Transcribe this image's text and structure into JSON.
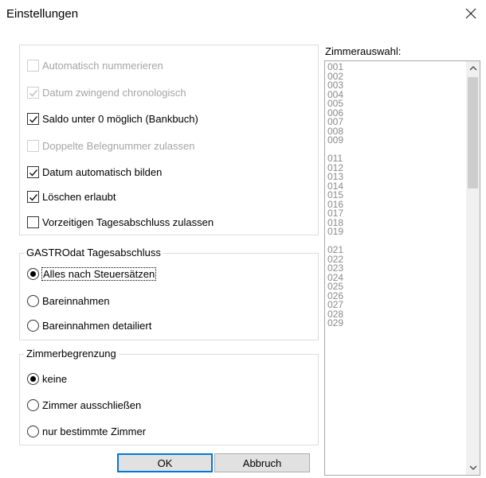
{
  "window": {
    "title": "Einstellungen"
  },
  "general": {
    "options": [
      {
        "label": "Automatisch nummerieren",
        "checked": false,
        "disabled": true
      },
      {
        "label": "Datum zwingend chronologisch",
        "checked": true,
        "disabled": true
      },
      {
        "label": "Saldo unter 0 möglich (Bankbuch)",
        "checked": true,
        "disabled": false
      },
      {
        "label": "Doppelte Belegnummer zulassen",
        "checked": false,
        "disabled": true
      },
      {
        "label": "Datum automatisch bilden",
        "checked": true,
        "disabled": false
      },
      {
        "label": "Löschen erlaubt",
        "checked": true,
        "disabled": false
      },
      {
        "label": "Vorzeitigen Tagesabschluss zulassen",
        "checked": false,
        "disabled": false
      }
    ]
  },
  "tagesabschluss": {
    "legend": "GASTROdat Tagesabschluss",
    "options": [
      {
        "label": "Alles nach Steuersätzen",
        "selected": true
      },
      {
        "label": "Bareinnahmen",
        "selected": false
      },
      {
        "label": "Bareinnahmen detailiert",
        "selected": false
      }
    ]
  },
  "zimmerbegrenzung": {
    "legend": "Zimmerbegrenzung",
    "options": [
      {
        "label": "keine",
        "selected": true
      },
      {
        "label": "Zimmer ausschließen",
        "selected": false
      },
      {
        "label": "nur bestimmte Zimmer",
        "selected": false
      }
    ]
  },
  "buttons": {
    "ok": "OK",
    "cancel": "Abbruch"
  },
  "zimmerauswahl": {
    "label": "Zimmerauswahl:",
    "items": [
      "001",
      "002",
      "003",
      "004",
      "005",
      "006",
      "007",
      "008",
      "009",
      "",
      "011",
      "012",
      "013",
      "014",
      "015",
      "016",
      "017",
      "018",
      "019",
      "",
      "021",
      "022",
      "023",
      "024",
      "025",
      "026",
      "027",
      "028",
      "029"
    ]
  },
  "icons": {
    "close": "close-icon",
    "scroll_up": "chevron-up-icon",
    "scroll_down": "chevron-down-icon",
    "check": "check-icon"
  }
}
